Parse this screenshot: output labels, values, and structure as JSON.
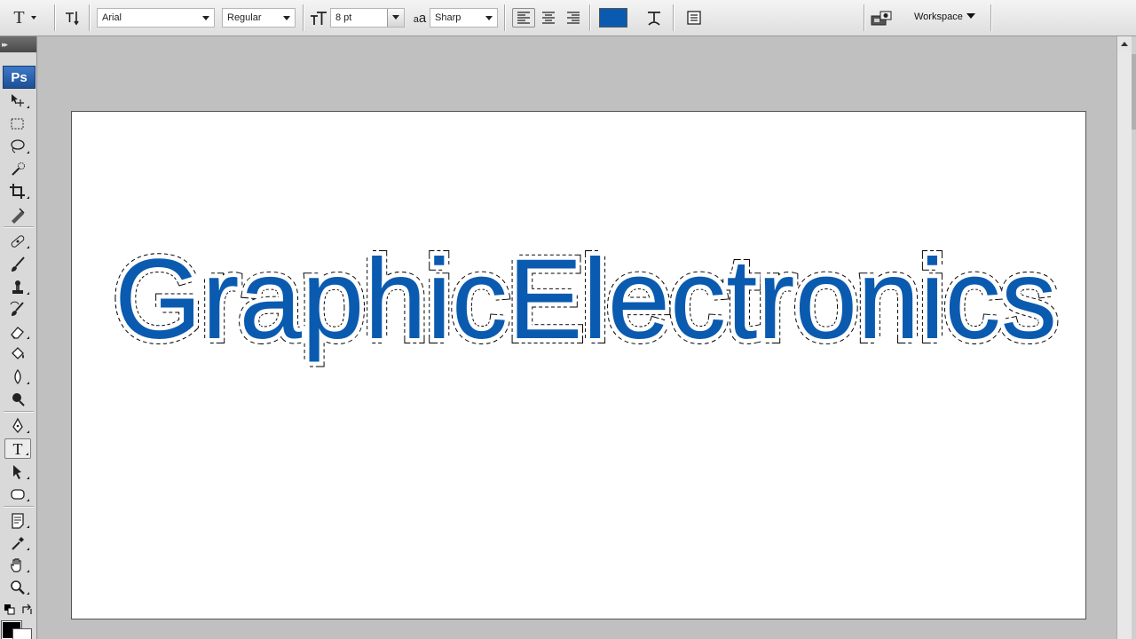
{
  "options_bar": {
    "tool_preset_glyph": "T",
    "font_family": "Arial",
    "font_style": "Regular",
    "font_size": "8 pt",
    "antialias_glyph": "a",
    "antialias_glyph_sub": "a",
    "antialias": "Sharp",
    "text_color": "#0a5bb0",
    "workspace_label": "Workspace"
  },
  "tools": {
    "logo": "Ps",
    "active_tool": "type-tool",
    "items": [
      "move-tool-icon",
      "marquee-tool-icon",
      "lasso-tool-icon",
      "quick-selection-tool-icon",
      "crop-tool-icon",
      "slice-tool-icon",
      "healing-brush-tool-icon",
      "brush-tool-icon",
      "clone-stamp-tool-icon",
      "history-brush-tool-icon",
      "eraser-tool-icon",
      "paint-bucket-tool-icon",
      "blur-tool-icon",
      "dodge-tool-icon",
      "pen-tool-icon",
      "type-tool-icon",
      "path-selection-tool-icon",
      "shape-tool-icon",
      "notes-tool-icon",
      "eyedropper-tool-icon",
      "hand-tool-icon",
      "zoom-tool-icon"
    ],
    "foreground_color": "#000000",
    "background_color": "#ffffff"
  },
  "document": {
    "canvas_color": "#ffffff",
    "text_layer": {
      "text": "GraphicElectronics",
      "color": "#0a5bb0",
      "selection": "marching-ants"
    }
  }
}
